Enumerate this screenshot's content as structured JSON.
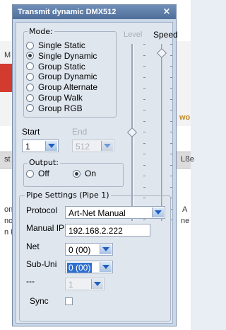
{
  "window": {
    "title": "Transmit dynamic DMX512",
    "close_glyph": "×"
  },
  "mode": {
    "legend": "Mode:",
    "options": [
      "Single Static",
      "Single Dynamic",
      "Group Static",
      "Group Dynamic",
      "Group Alternate",
      "Group Walk",
      "Group RGB"
    ],
    "selected": "Single Dynamic"
  },
  "sliders": {
    "level_label": "Level",
    "speed_label": "Speed",
    "level_value": 0.5,
    "speed_value": 0.95
  },
  "range": {
    "start_label": "Start",
    "start_value": "1",
    "end_label": "End",
    "end_value": "512"
  },
  "output": {
    "legend": "Output:",
    "off_label": "Off",
    "on_label": "On",
    "selected": "On"
  },
  "pipe": {
    "legend": "Pipe Settings (Pipe 1)",
    "protocol_label": "Protocol",
    "protocol_value": "Art-Net Manual",
    "manual_ip_label": "Manual IP",
    "manual_ip_value": "192.168.2.222",
    "net_label": "Net",
    "net_value": "0 (00)",
    "subuni_label": "Sub-Uni",
    "subuni_value": "0 (00)",
    "dash_label": "---",
    "dash_value": "1",
    "sync_label": "Sync"
  },
  "background": {
    "fragments": [
      "M",
      "st",
      "onv",
      "nop",
      "n I",
      "Lßе",
      "wo",
      "A",
      "ne"
    ]
  },
  "colors": {
    "title_bar": "#5a7aa5",
    "panel": "#dfe6ee",
    "selection": "#2f6fd0"
  }
}
